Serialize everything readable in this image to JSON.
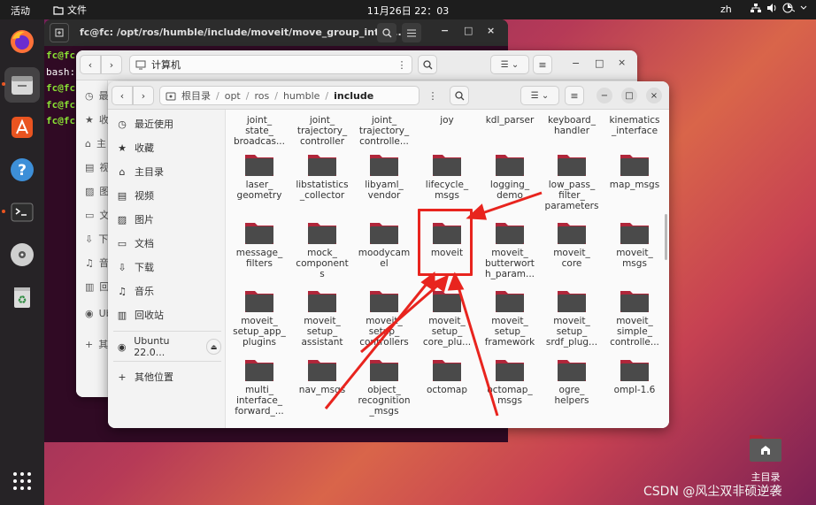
{
  "topbar": {
    "activities": "活动",
    "app_name": "文件",
    "clock": "11月26日 22：03",
    "lang": "zh"
  },
  "dock": [
    "firefox-icon",
    "files-icon",
    "app-center-icon",
    "help-icon",
    "terminal-icon",
    "disc-icon",
    "trash-icon",
    "app-grid-icon"
  ],
  "terminal": {
    "title": "fc@fc: /opt/ros/humble/include/moveit/move_group_interf...",
    "lines": [
      "fc@fc",
      "bash:",
      "fc@fc",
      "fc@fc",
      "fc@fc"
    ]
  },
  "win2": {
    "location": "计算机",
    "sidebar": [
      "最",
      "收",
      "主",
      "视",
      "图",
      "文",
      "下",
      "音",
      "回",
      "Ub",
      "其"
    ]
  },
  "win3": {
    "path": [
      "根目录",
      "opt",
      "ros",
      "humble",
      "include"
    ],
    "sidebar": {
      "recent": "最近使用",
      "starred": "收藏",
      "home": "主目录",
      "videos": "视频",
      "pictures": "图片",
      "documents": "文档",
      "downloads": "下载",
      "music": "音乐",
      "trash": "回收站",
      "ubuntu": "Ubuntu 22.0...",
      "other": "其他位置"
    },
    "top_row": [
      "joint_\nstate_\nbroadcas...",
      "joint_\ntrajectory_\ncontroller",
      "joint_\ntrajectory_\ncontrolle...",
      "joy",
      "kdl_parser",
      "keyboard_\nhandler",
      "kinematics\n_interface"
    ],
    "folders": [
      [
        "laser_\ngeometry",
        "libstatistics\n_collector",
        "libyaml_\nvendor",
        "lifecycle_\nmsgs",
        "logging_\ndemo",
        "low_pass_\nfilter_\nparameters",
        "map_msgs"
      ],
      [
        "message_\nfilters",
        "mock_\ncomponent\ns",
        "moodycam\nel",
        "moveit",
        "moveit_\nbutterwort\nh_param...",
        "moveit_\ncore",
        "moveit_\nmsgs"
      ],
      [
        "moveit_\nsetup_app_\nplugins",
        "moveit_\nsetup_\nassistant",
        "moveit_\nsetup_\ncontrollers",
        "moveit_\nsetup_\ncore_plu...",
        "moveit_\nsetup_\nframework",
        "moveit_\nsetup_\nsrdf_plug...",
        "moveit_\nsimple_\ncontrolle..."
      ],
      [
        "multi_\ninterface_\nforward_...",
        "nav_msgs",
        "object_\nrecognition\n_msgs",
        "octomap",
        "octomap_\nmsgs",
        "ogre_\nhelpers",
        "ompl-1.6"
      ]
    ]
  },
  "desktop": {
    "home_label": "主目录"
  },
  "watermark": "CSDN @风尘双非硕逆袭",
  "colors": {
    "highlight": "#e8241e",
    "folder": "#4a4a4a",
    "folder_tab": "#b0263a"
  }
}
